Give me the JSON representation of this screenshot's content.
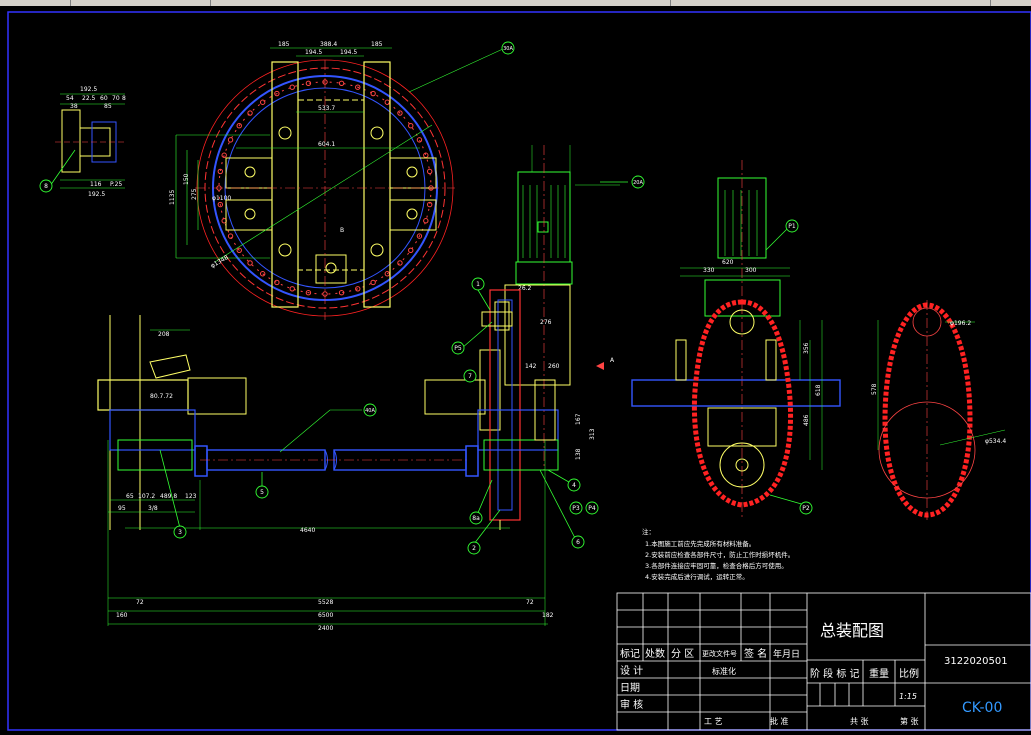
{
  "drawing": {
    "callouts": [
      "30A",
      "20A",
      "P1",
      "8",
      "1",
      "P5",
      "7",
      "40A",
      "5",
      "3",
      "8a",
      "2",
      "6",
      "4",
      "P3",
      "P4",
      "P2"
    ],
    "dims_top_view": [
      "185",
      "388.4",
      "185",
      "194.5",
      "194.5",
      "533.7",
      "604.1",
      "150",
      "1135",
      "1350",
      "275",
      "485",
      "φ1100",
      "φ1348"
    ],
    "dims_side": [
      "192.5",
      "54",
      "22.5",
      "60",
      "70",
      "8",
      "38",
      "85",
      "116",
      "P.25",
      "192.5"
    ],
    "dims_elevation": [
      "208",
      "80.7.72",
      "65",
      "107.2",
      "489.8",
      "123",
      "95",
      "3/8",
      "4640",
      "5528",
      "6500",
      "2400",
      "160",
      "72",
      "72",
      "182"
    ],
    "dims_gear_box": [
      "26.2",
      "276",
      "142",
      "260",
      "167",
      "138",
      "313"
    ],
    "dims_right_view": [
      "330",
      "300",
      "620",
      "356",
      "618",
      "486",
      "φ196.2",
      "φ534.4",
      "578"
    ],
    "section_mark": "A",
    "b_label": "B"
  },
  "notes": {
    "heading": "注：",
    "items": [
      "1.本图施工前应先完成所有材料准备。",
      "2.安装前应检查各部件尺寸，防止工作时损坏机件。",
      "3.各部件连接应牢固可靠，检查合格后方可使用。",
      "4.安装完成后进行调试，运转正常。"
    ]
  },
  "title_block": {
    "drawing_title": "总装配图",
    "drawing_number": "3122020501",
    "code": "CK-00",
    "headers": [
      "标记",
      "处数",
      "分 区",
      "更改文件号",
      "签 名",
      "年月日"
    ],
    "rows": [
      "设 计",
      "日期",
      "审 核"
    ],
    "standardization": "标准化",
    "stage_headers": [
      "阶 段 标 记",
      "重量",
      "比例"
    ],
    "scale": "1:15",
    "craft": "工 艺",
    "approve": "批 准",
    "sheets": [
      "共 张",
      "第 张"
    ]
  }
}
